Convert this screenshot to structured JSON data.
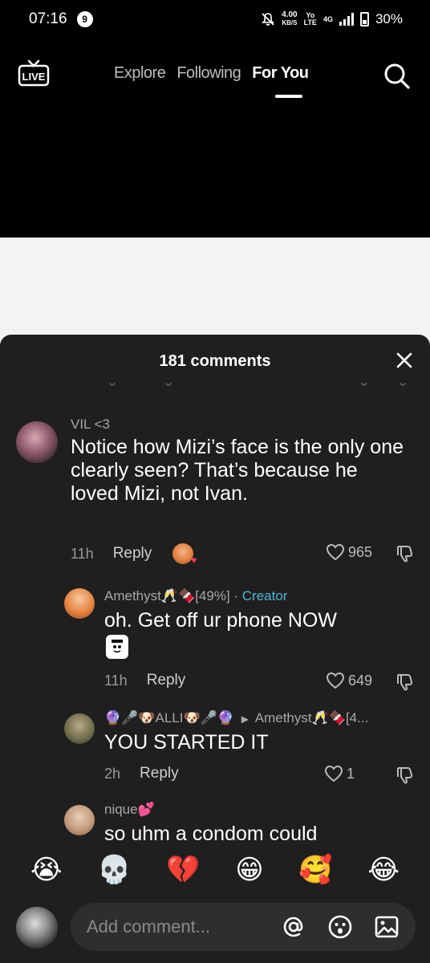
{
  "status_bar": {
    "time": "07:16",
    "notif_count": "9",
    "speed_value": "4.00",
    "speed_unit": "KB/S",
    "volte_top": "Yo",
    "volte_bottom": "LTE",
    "network": "4G",
    "battery": "30%"
  },
  "nav": {
    "tabs": [
      {
        "label": "Explore",
        "active": false
      },
      {
        "label": "Following",
        "active": false
      },
      {
        "label": "For You",
        "active": true
      }
    ],
    "live_label": "LIVE"
  },
  "comments_panel": {
    "title": "181 comments",
    "comments": [
      {
        "username": "VIL <3",
        "text": "Notice how Mizi’s face is the only one clearly seen? That’s because he loved Mizi, not Ivan.",
        "time": "11h",
        "reply_label": "Reply",
        "likes": "965"
      },
      {
        "username": "Amethyst🥂🍫[49%]",
        "separator": " · ",
        "badge": "Creator",
        "text": "oh. Get off ur phone NOW",
        "time": "11h",
        "reply_label": "Reply",
        "likes": "649"
      },
      {
        "username": "🔮🎤🐶ALLI🐶🎤🔮",
        "reply_to": "Amethyst🥂🍫[4...",
        "text": "YOU STARTED IT",
        "time": "2h",
        "reply_label": "Reply",
        "likes": "1"
      },
      {
        "username": "nique💕",
        "text": "so uhm a condom could"
      }
    ]
  },
  "emoji_bar": [
    "😭",
    "💀",
    "💔",
    "😁",
    "🥰",
    "😂"
  ],
  "input": {
    "placeholder": "Add comment..."
  },
  "colors": {
    "sheet_bg": "#1f1f1f",
    "creator_badge": "#4fb7d9",
    "meta_text": "#9a9a9a"
  }
}
